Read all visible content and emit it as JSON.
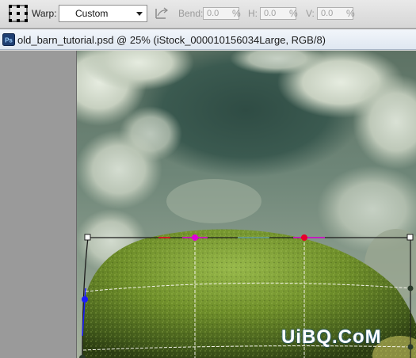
{
  "options_bar": {
    "warp_label": "Warp:",
    "warp_style": "Custom",
    "bend_label": "Bend:",
    "bend_value": "0.0",
    "bend_unit": "%",
    "h_label": "H:",
    "h_value": "0.0",
    "h_unit": "%",
    "v_label": "V:",
    "v_value": "0.0",
    "v_unit": "%"
  },
  "document": {
    "app_icon_letters": "Ps",
    "title": "old_barn_tutorial.psd @ 25% (iStock_000010156034Large, RGB/8)"
  },
  "icons": {
    "warp_grid": "warp-grid-icon",
    "orientation": "change-warp-orientation-icon",
    "app": "photoshop-document-icon"
  },
  "colors": {
    "warp_grid": "#1c1c1c",
    "anchor_magenta": "#e000d8",
    "anchor_red": "#e8002a",
    "anchor_blue": "#1a1aff",
    "handle_dark": "#2a3a2a",
    "watermark_blue": "#1e5fa8"
  },
  "watermark": "UiBQ.CoM"
}
